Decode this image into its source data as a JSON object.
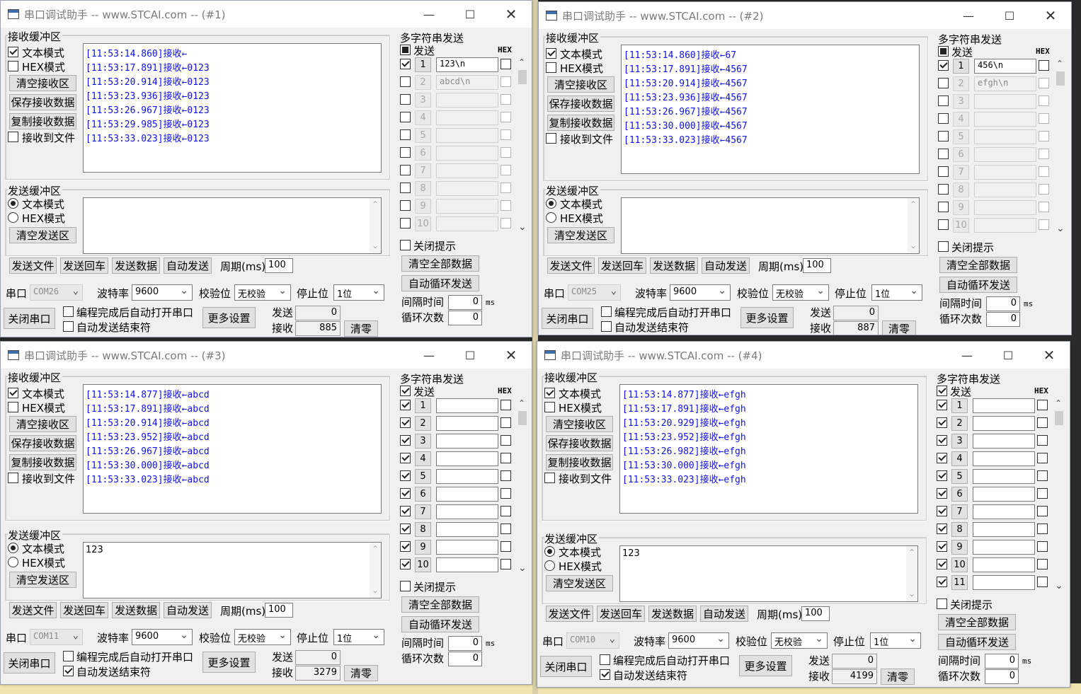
{
  "common": {
    "recv_group": "接收缓冲区",
    "text_mode": "文本模式",
    "hex_mode": "HEX模式",
    "clear_recv": "清空接收区",
    "save_recv": "保存接收数据",
    "copy_recv": "复制接收数据",
    "recv_to_file": "接收到文件",
    "send_group": "发送缓冲区",
    "clear_send": "清空发送区",
    "send_file": "发送文件",
    "send_enter": "发送回车",
    "send_data": "发送数据",
    "auto_send": "自动发送",
    "period_label": "周期(ms)",
    "period_value": "100",
    "port_label": "串口",
    "baud_label": "波特率",
    "baud_value": "9600",
    "parity_label": "校验位",
    "parity_value": "无校验",
    "stop_label": "停止位",
    "stop_value": "1位",
    "close_port": "关闭串口",
    "auto_open": "编程完成后自动打开串口",
    "auto_send_end": "自动发送结束符",
    "more_settings": "更多设置",
    "send_count_label": "发送",
    "recv_count_label": "接收",
    "clear_counts": "清零",
    "multi_title": "多字符串发送",
    "send_col": "发送",
    "hex_col": "HEX",
    "close_prompt": "关闭提示",
    "clear_all": "清空全部数据",
    "auto_loop": "自动循环发送",
    "interval_label": "间隔时间",
    "interval_value": "0",
    "interval_unit": "ms",
    "loop_label": "循环次数",
    "loop_value": "0",
    "min_glyph": "—",
    "max_glyph": "☐",
    "close_glyph": "✕",
    "dropdown_glyph": "⌄"
  },
  "windows": [
    {
      "title": "串口调试助手 -- www.STCAI.com -- (#1)",
      "recv_lines": [
        "[11:53:14.860]接收←",
        "[11:53:17.891]接收←0123",
        "[11:53:20.914]接收←0123",
        "[11:53:23.936]接收←0123",
        "[11:53:26.967]接收←0123",
        "[11:53:29.985]接收←0123",
        "[11:53:33.023]接收←0123"
      ],
      "send_text": "",
      "port": "COM26",
      "send_count": "0",
      "recv_count": "885",
      "auto_send_end_checked": false,
      "header_send_state": "square",
      "rows": [
        {
          "num": "1",
          "value": "123\\n",
          "checked": true,
          "enabled": true
        },
        {
          "num": "2",
          "value": "abcd\\n",
          "checked": false,
          "enabled": false
        },
        {
          "num": "3",
          "value": "",
          "checked": false,
          "enabled": false
        },
        {
          "num": "4",
          "value": "",
          "checked": false,
          "enabled": false
        },
        {
          "num": "5",
          "value": "",
          "checked": false,
          "enabled": false
        },
        {
          "num": "6",
          "value": "",
          "checked": false,
          "enabled": false
        },
        {
          "num": "7",
          "value": "",
          "checked": false,
          "enabled": false
        },
        {
          "num": "8",
          "value": "",
          "checked": false,
          "enabled": false
        },
        {
          "num": "9",
          "value": "",
          "checked": false,
          "enabled": false
        },
        {
          "num": "10",
          "value": "",
          "checked": false,
          "enabled": false
        }
      ]
    },
    {
      "title": "串口调试助手 -- www.STCAI.com -- (#2)",
      "recv_lines": [
        "[11:53:14.860]接收←67",
        "[11:53:17.891]接收←4567",
        "[11:53:20.914]接收←4567",
        "[11:53:23.936]接收←4567",
        "[11:53:26.967]接收←4567",
        "[11:53:30.000]接收←4567",
        "[11:53:33.023]接收←4567"
      ],
      "send_text": "",
      "port": "COM25",
      "send_count": "0",
      "recv_count": "887",
      "auto_send_end_checked": false,
      "header_send_state": "square",
      "rows": [
        {
          "num": "1",
          "value": "456\\n",
          "checked": true,
          "enabled": true
        },
        {
          "num": "2",
          "value": "efgh\\n",
          "checked": false,
          "enabled": false
        },
        {
          "num": "3",
          "value": "",
          "checked": false,
          "enabled": false
        },
        {
          "num": "4",
          "value": "",
          "checked": false,
          "enabled": false
        },
        {
          "num": "5",
          "value": "",
          "checked": false,
          "enabled": false
        },
        {
          "num": "6",
          "value": "",
          "checked": false,
          "enabled": false
        },
        {
          "num": "7",
          "value": "",
          "checked": false,
          "enabled": false
        },
        {
          "num": "8",
          "value": "",
          "checked": false,
          "enabled": false
        },
        {
          "num": "9",
          "value": "",
          "checked": false,
          "enabled": false
        },
        {
          "num": "10",
          "value": "",
          "checked": false,
          "enabled": false
        }
      ]
    },
    {
      "title": "串口调试助手 -- www.STCAI.com -- (#3)",
      "recv_lines": [
        "[11:53:14.877]接收←abcd",
        "[11:53:17.891]接收←abcd",
        "[11:53:20.914]接收←abcd",
        "[11:53:23.952]接收←abcd",
        "[11:53:26.967]接收←abcd",
        "[11:53:30.000]接收←abcd",
        "[11:53:33.023]接收←abcd"
      ],
      "send_text": "123",
      "port": "COM11",
      "send_count": "0",
      "recv_count": "3279",
      "auto_send_end_checked": true,
      "header_send_state": "checked",
      "rows": [
        {
          "num": "1",
          "value": "",
          "checked": true,
          "enabled": true
        },
        {
          "num": "2",
          "value": "",
          "checked": true,
          "enabled": true
        },
        {
          "num": "3",
          "value": "",
          "checked": true,
          "enabled": true
        },
        {
          "num": "4",
          "value": "",
          "checked": true,
          "enabled": true
        },
        {
          "num": "5",
          "value": "",
          "checked": true,
          "enabled": true
        },
        {
          "num": "6",
          "value": "",
          "checked": true,
          "enabled": true
        },
        {
          "num": "7",
          "value": "",
          "checked": true,
          "enabled": true
        },
        {
          "num": "8",
          "value": "",
          "checked": true,
          "enabled": true
        },
        {
          "num": "9",
          "value": "",
          "checked": true,
          "enabled": true
        },
        {
          "num": "10",
          "value": "",
          "checked": true,
          "enabled": true
        }
      ]
    },
    {
      "title": "串口调试助手 -- www.STCAI.com -- (#4)",
      "recv_lines": [
        "[11:53:14.877]接收←efgh",
        "[11:53:17.891]接收←efgh",
        "[11:53:20.929]接收←efgh",
        "[11:53:23.952]接收←efgh",
        "[11:53:26.982]接收←efgh",
        "[11:53:30.000]接收←efgh",
        "[11:53:33.023]接收←efgh"
      ],
      "send_text": "123",
      "port": "COM10",
      "send_count": "0",
      "recv_count": "4199",
      "auto_send_end_checked": true,
      "header_send_state": "checked",
      "rows": [
        {
          "num": "1",
          "value": "",
          "checked": true,
          "enabled": true
        },
        {
          "num": "2",
          "value": "",
          "checked": true,
          "enabled": true
        },
        {
          "num": "3",
          "value": "",
          "checked": true,
          "enabled": true
        },
        {
          "num": "4",
          "value": "",
          "checked": true,
          "enabled": true
        },
        {
          "num": "5",
          "value": "",
          "checked": true,
          "enabled": true
        },
        {
          "num": "6",
          "value": "",
          "checked": true,
          "enabled": true
        },
        {
          "num": "7",
          "value": "",
          "checked": true,
          "enabled": true
        },
        {
          "num": "8",
          "value": "",
          "checked": true,
          "enabled": true
        },
        {
          "num": "9",
          "value": "",
          "checked": true,
          "enabled": true
        },
        {
          "num": "10",
          "value": "",
          "checked": true,
          "enabled": true
        },
        {
          "num": "11",
          "value": "",
          "checked": true,
          "enabled": true
        }
      ]
    }
  ]
}
